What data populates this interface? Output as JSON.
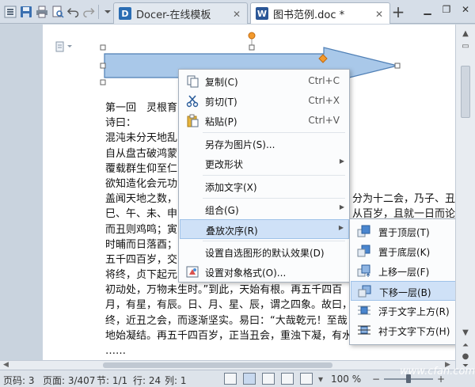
{
  "tabs": [
    {
      "label": "Docer-在线模板",
      "logo": "D",
      "color": "#2b6db3"
    },
    {
      "label": "图书范例.doc *",
      "logo": "W",
      "color": "#2b5797"
    }
  ],
  "document": {
    "lines": [
      "第一回　灵根育",
      "诗曰：",
      "混沌未分天地乱",
      "自从盘古破鸿蒙",
      "覆载群生仰至仁",
      "欲知造化会元功",
      "盖闻天地之数，",
      "巳、午、未、申",
      "而丑则鸡鸣；寅",
      "时晡而日落酉；",
      "五千四百岁，交",
      "将终，贞下起元，近于之会，而复逐渐开明。邵康节",
      "初动处，万物未生时。”到此，天始有根。再五千四百",
      "月，有星，有辰。日、月、星、辰，谓之四象。故曰，",
      "终，近丑之会，而逐渐坚实。易曰：“大哉乾元！至哉",
      "地始凝结。再五千四百岁，正当丑会，重浊下凝，有水",
      "……"
    ],
    "right_fragments": [
      "分为十二会，乃子、丑、",
      "从百岁，且就一日而论"
    ]
  },
  "context_menu": {
    "items": [
      {
        "label": "复制(C)",
        "shortcut": "Ctrl+C",
        "icon": "copy-icon"
      },
      {
        "label": "剪切(T)",
        "shortcut": "Ctrl+X",
        "icon": "scissors-icon"
      },
      {
        "label": "粘贴(P)",
        "shortcut": "Ctrl+V",
        "icon": "paste-icon"
      },
      {
        "label": "另存为图片(S)...",
        "icon": ""
      },
      {
        "label": "更改形状",
        "submenu": true
      },
      {
        "label": "添加文字(X)"
      },
      {
        "label": "组合(G)",
        "submenu": true
      },
      {
        "label": "叠放次序(R)",
        "submenu": true,
        "highlighted": true
      },
      {
        "label": "设置自选图形的默认效果(D)"
      },
      {
        "label": "设置对象格式(O)...",
        "icon": "format-object-icon"
      }
    ]
  },
  "submenu": {
    "items": [
      {
        "label": "置于顶层(T)",
        "icon": "bring-to-front-icon"
      },
      {
        "label": "置于底层(K)",
        "icon": "send-to-back-icon"
      },
      {
        "label": "上移一层(F)",
        "icon": "bring-forward-icon"
      },
      {
        "label": "下移一层(B)",
        "icon": "send-backward-icon",
        "highlighted": true
      },
      {
        "label": "浮于文字上方(R)",
        "icon": "in-front-of-text-icon"
      },
      {
        "label": "衬于文字下方(H)",
        "icon": "behind-text-icon"
      }
    ]
  },
  "status": {
    "page_code": "页码: 3",
    "page": "页面: 3/407",
    "section": "节: 1/1",
    "row": "行: 24",
    "col": "列: 1",
    "zoom": "100 %"
  },
  "watermark": "www.cfan.com.cn",
  "colors": {
    "accent": "#2b6db3",
    "shape_fill": "#a9c8e9",
    "shape_stroke": "#4f7fb5",
    "highlight": "#cfe1f7"
  }
}
